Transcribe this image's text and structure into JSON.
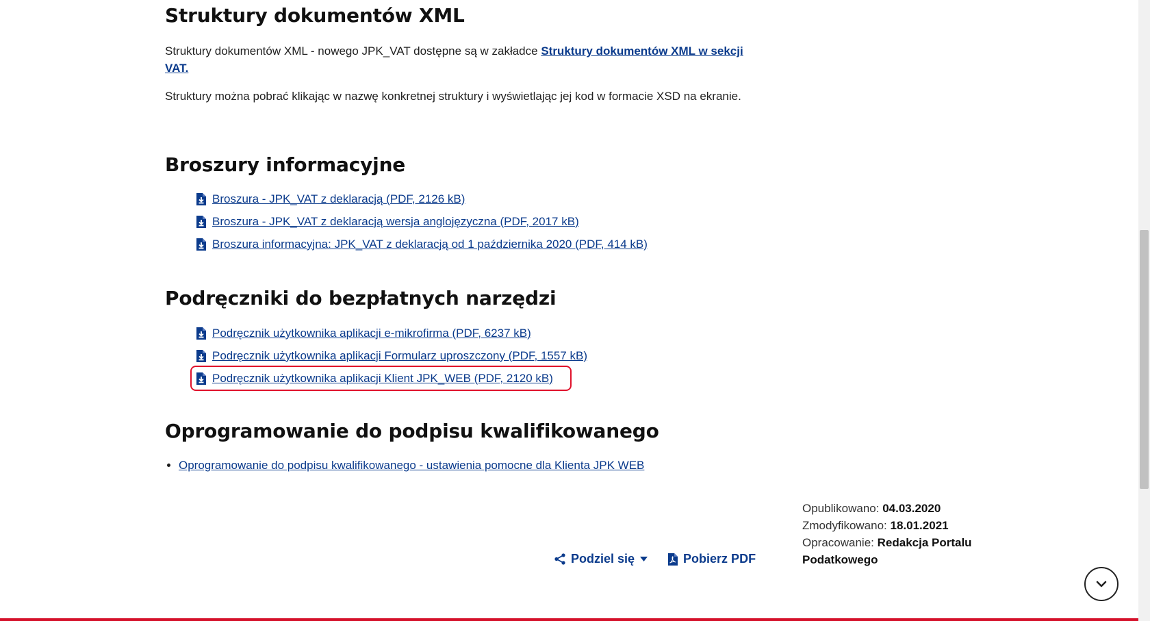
{
  "sections": {
    "xml": {
      "title": "Struktury dokumentów XML",
      "p1_text": "Struktury dokumentów XML - nowego JPK_VAT dostępne są w zakładce ",
      "p1_link": "Struktury dokumentów XML w sekcji VAT.",
      "p2_text": "Struktury można pobrać klikając w nazwę konkretnej struktury i wyświetlając jej kod w formacie XSD na ekranie."
    },
    "broszury": {
      "title": "Broszury informacyjne",
      "items": [
        {
          "label": "Broszura - JPK_VAT z deklaracją (PDF, 2126 kB)"
        },
        {
          "label": "Broszura - JPK_VAT z deklaracją wersja anglojęzyczna (PDF, 2017 kB)"
        },
        {
          "label": "Broszura informacyjna: JPK_VAT z deklaracją od 1 października 2020 (PDF, 414 kB)"
        }
      ]
    },
    "podreczniki": {
      "title": "Podręczniki do bezpłatnych narzędzi",
      "items": [
        {
          "label": "Podręcznik użytkownika aplikacji e-mikrofirma (PDF, 6237 kB)"
        },
        {
          "label": "Podręcznik użytkownika aplikacji Formularz uproszczony (PDF, 1557 kB)"
        },
        {
          "label": "Podręcznik użytkownika aplikacji Klient JPK_WEB (PDF, 2120 kB)"
        }
      ]
    },
    "oprogramowanie": {
      "title": "Oprogramowanie do podpisu kwalifikowanego",
      "items": [
        {
          "label": "Oprogramowanie do podpisu kwalifikowanego - ustawienia pomocne dla Klienta JPK WEB"
        }
      ]
    }
  },
  "meta": {
    "published_label": "Opublikowano:",
    "published_value": "04.03.2020",
    "modified_label": "Zmodyfikowano:",
    "modified_value": "18.01.2021",
    "author_label": "Opracowanie:",
    "author_value": "Redakcja Portalu Podatkowego"
  },
  "actions": {
    "share_label": "Podziel się",
    "pdf_label": "Pobierz PDF"
  },
  "colors": {
    "link": "#0b3b8c",
    "highlight": "#e0112b",
    "bottom_bar": "#d5112a"
  },
  "icons": {
    "download": "file-download-icon",
    "share": "share-icon",
    "pdf": "pdf-file-icon",
    "scroll": "chevron-down-icon"
  }
}
